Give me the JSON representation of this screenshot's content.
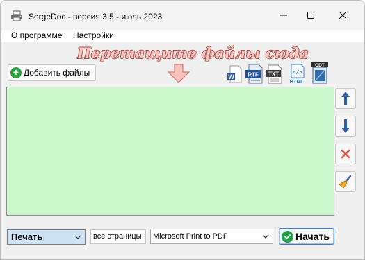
{
  "window": {
    "title": "SergeDoc - версия 3.5  - июль 2023",
    "icon": "printer-icon"
  },
  "menu": {
    "items": [
      {
        "label": "О программе"
      },
      {
        "label": "Настройки"
      }
    ]
  },
  "main": {
    "drop_hint": "Перетащите файлы сюда",
    "add_files_label": "Добавить файлы",
    "format_icons": [
      {
        "name": "word-icon",
        "label": "W"
      },
      {
        "name": "rtf-icon",
        "label": "RTF"
      },
      {
        "name": "txt-icon",
        "label": "TXT"
      },
      {
        "name": "html-icon",
        "label": "HTML"
      },
      {
        "name": "odt-icon",
        "label": "ODT"
      }
    ],
    "file_list_color": "#ccf9cc"
  },
  "side_buttons": [
    {
      "name": "move-up-button",
      "icon": "arrow-up-icon"
    },
    {
      "name": "move-down-button",
      "icon": "arrow-down-icon"
    },
    {
      "name": "remove-button",
      "icon": "x-icon"
    },
    {
      "name": "clear-button",
      "icon": "broom-icon"
    }
  ],
  "bottom": {
    "mode_value": "Печать",
    "pages_value": "все страницы",
    "printer_value": "Microsoft Print to PDF",
    "start_label": "Начать"
  }
}
